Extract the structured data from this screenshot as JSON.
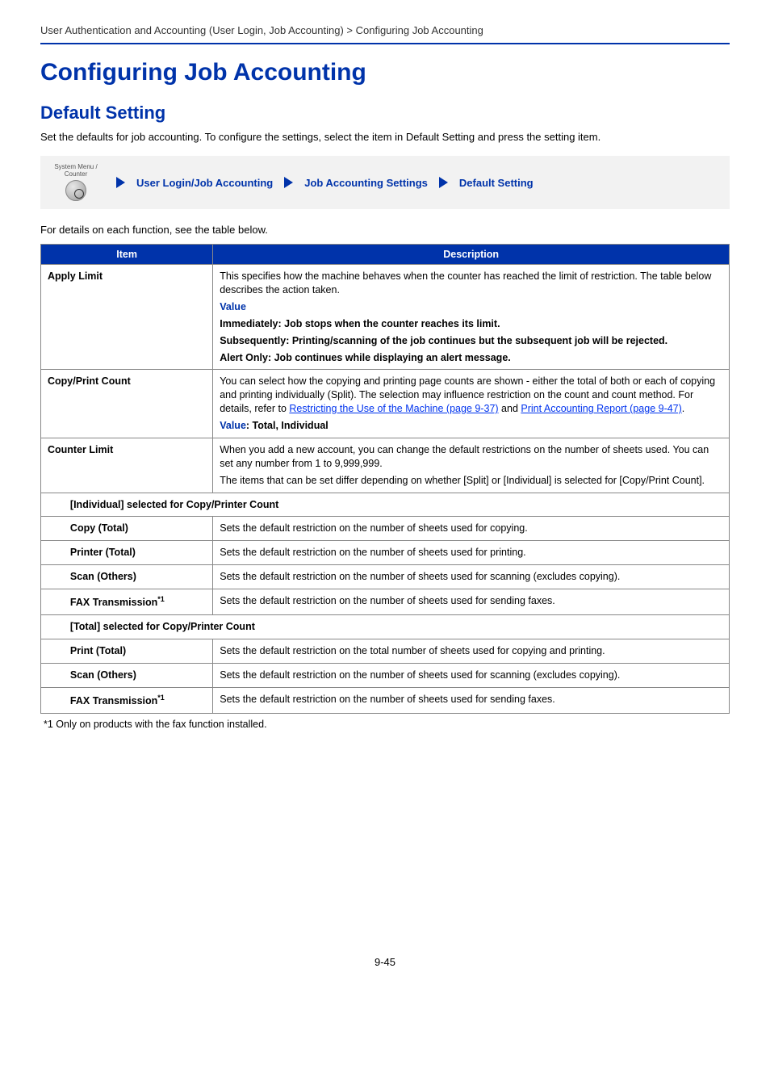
{
  "header": {
    "breadcrumb": "User Authentication and Accounting (User Login, Job Accounting) > Configuring Job Accounting"
  },
  "title_h1": "Configuring Job Accounting",
  "title_h2": "Default Setting",
  "intro": "Set the defaults for job accounting. To configure the settings, select the item in Default Setting and press the setting item.",
  "navbox": {
    "sysmenu_top": "System Menu /",
    "sysmenu_bottom": "Counter",
    "step1": "User Login/Job Accounting",
    "step2": "Job Accounting Settings",
    "step3": "Default Setting"
  },
  "pre_table": "For details on each function, see the table below.",
  "table": {
    "head_item": "Item",
    "head_desc": "Description",
    "apply_limit": {
      "name": "Apply Limit",
      "p1": "This specifies how the machine behaves when the counter has reached the limit of restriction. The table below describes the action taken.",
      "value_label": "Value",
      "v_immediate": "Immediately: Job stops when the counter reaches its limit.",
      "v_subsequent": "Subsequently: Printing/scanning of the job continues but the subsequent job will be rejected.",
      "v_alert": "Alert Only: Job continues while displaying an alert message."
    },
    "copy_print_count": {
      "name": "Copy/Print Count",
      "p1a": "You can select how the copying and printing page counts are shown - either the total of both or each of copying and printing individually (Split). The selection may influence restriction on the count and count method. For details, refer to ",
      "link1": "Restricting the Use of the Machine (page 9-37)",
      "p1b": " and ",
      "link2": "Print Accounting Report (page 9-47)",
      "p1c": ".",
      "value_full_label": "Value",
      "value_full_rest": ": Total, Individual"
    },
    "counter_limit": {
      "name": "Counter Limit",
      "p1": "When you add a new account, you can change the default restrictions on the number of sheets used. You can set any number from 1 to 9,999,999.",
      "p2": "The items that can be set differ depending on whether [Split] or [Individual] is selected for [Copy/Print Count]."
    },
    "section_individual": "[Individual] selected for Copy/Printer Count",
    "copy_total": {
      "name": "Copy (Total)",
      "desc": "Sets the default restriction on the number of sheets used for copying."
    },
    "printer_total": {
      "name": "Printer (Total)",
      "desc": "Sets the default restriction on the number of sheets used for printing."
    },
    "scan_others_1": {
      "name": "Scan (Others)",
      "desc": "Sets the default restriction on the number of sheets used for scanning (excludes copying)."
    },
    "fax_1": {
      "name": "FAX Transmission",
      "sup": "*1",
      "desc": "Sets the default restriction on the number of sheets used for sending faxes."
    },
    "section_total": "[Total] selected for Copy/Printer Count",
    "print_total": {
      "name": "Print (Total)",
      "desc": "Sets the default restriction on the total number of sheets used for copying and printing."
    },
    "scan_others_2": {
      "name": "Scan (Others)",
      "desc": "Sets the default restriction on the number of sheets used for scanning (excludes copying)."
    },
    "fax_2": {
      "name": "FAX Transmission",
      "sup": "*1",
      "desc": "Sets the default restriction on the number of sheets used for sending faxes."
    }
  },
  "footnote": "*1   Only on products with the fax function installed.",
  "page_number": "9-45"
}
